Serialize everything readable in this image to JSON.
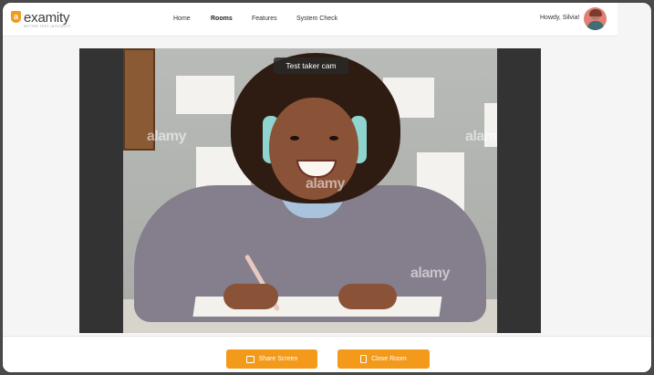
{
  "brand": {
    "logo_letter": "a",
    "name": "examity",
    "tagline": "BETTER TEST INTEGRITY",
    "accent_color": "#f39a1b"
  },
  "nav": {
    "items": [
      {
        "label": "Home"
      },
      {
        "label": "Rooms",
        "active": true
      },
      {
        "label": "Features"
      },
      {
        "label": "System Check"
      }
    ]
  },
  "user": {
    "greeting": "Howdy, Silvia!",
    "avatar_icon": "user-avatar"
  },
  "video": {
    "label": "Test taker cam",
    "watermark": "alamy"
  },
  "actions": {
    "share_label": "Share Screen",
    "share_icon": "screen-share-icon",
    "close_label": "Close Room",
    "close_icon": "door-exit-icon"
  }
}
